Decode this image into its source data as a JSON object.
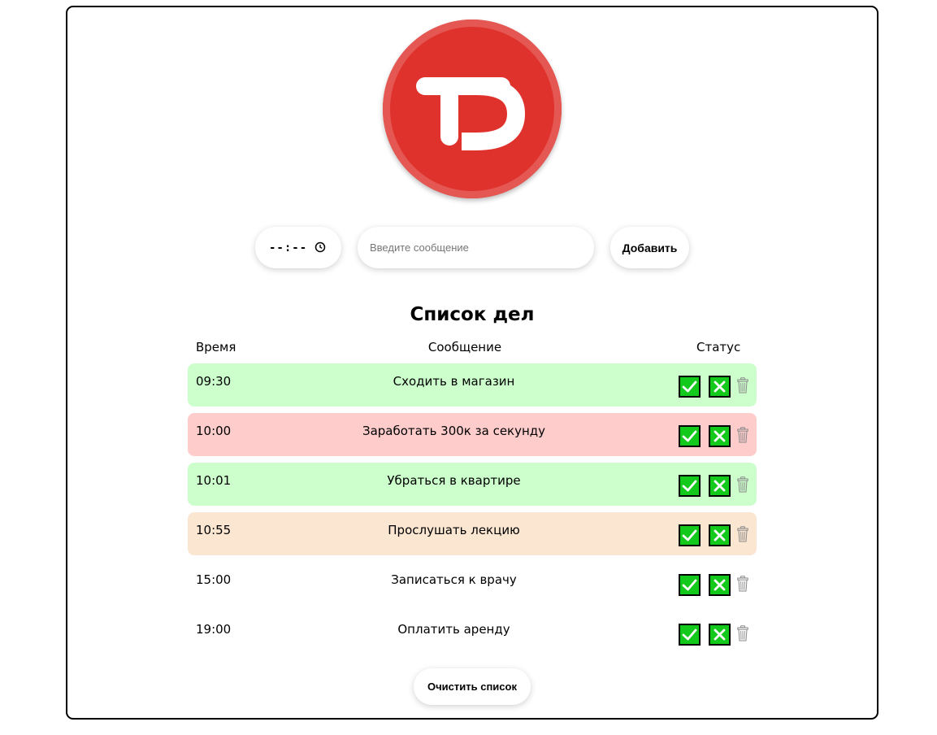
{
  "logo": {
    "text": "TD",
    "color": "#e0322d"
  },
  "form": {
    "time_value": "--:--",
    "message_placeholder": "Введите сообщение",
    "add_label": "Добавить"
  },
  "list": {
    "title": "Список дел",
    "headers": {
      "time": "Время",
      "message": "Сообщение",
      "status": "Статус"
    },
    "items": [
      {
        "time": "09:30",
        "message": "Сходить в магазин",
        "bg": "#ccffcc"
      },
      {
        "time": "10:00",
        "message": "Заработать 300к за секунду",
        "bg": "#ffcccc"
      },
      {
        "time": "10:01",
        "message": "Убраться в квартире",
        "bg": "#ccffcc"
      },
      {
        "time": "10:55",
        "message": "Прослушать лекцию",
        "bg": "#fbe6d2"
      },
      {
        "time": "15:00",
        "message": "Записаться к врачу",
        "bg": "#ffffff"
      },
      {
        "time": "19:00",
        "message": "Оплатить аренду",
        "bg": "#ffffff"
      }
    ],
    "icons": {
      "done": "check-icon",
      "cancel": "cross-icon",
      "delete": "trash-icon"
    },
    "button_color": "#13c91b"
  },
  "clear_label": "Очистить список"
}
